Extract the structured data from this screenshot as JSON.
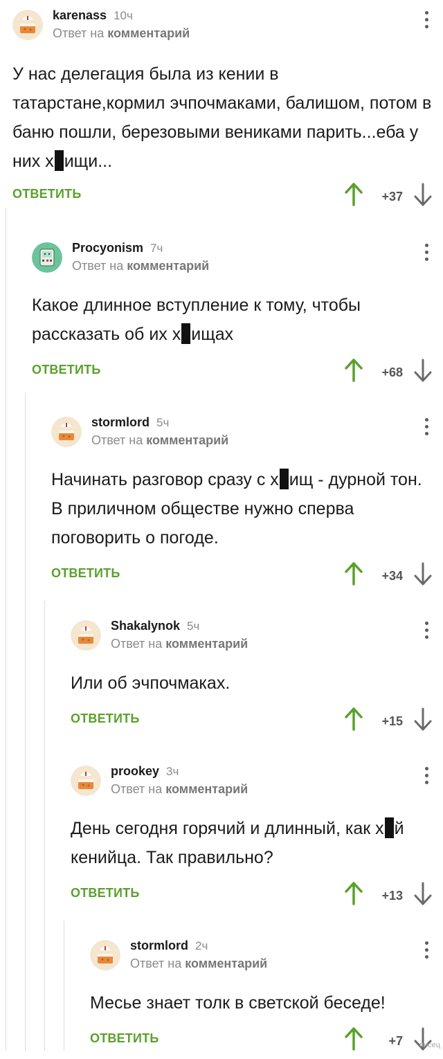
{
  "reply_prefix": "Ответ на",
  "reply_target": "комментарий",
  "answer_label": "ОТВЕТИТЬ",
  "colors": {
    "accent_green": "#5aa02c",
    "muted": "#8a8a8a"
  },
  "watermark": "писец",
  "comments": [
    {
      "user": "karenass",
      "time": "10ч",
      "avatar_icon": "cake-avatar-icon",
      "parts": [
        "У нас делегация была из кении в татарстане,кормил эчпочмаками, балишом, потом в баню пошли, березовыми вениками парить...еба у них х",
        "ищи..."
      ],
      "score": "+37"
    },
    {
      "user": "Procyonism",
      "time": "7ч",
      "avatar_icon": "robot-avatar-icon",
      "parts": [
        "Какое длинное вступление к тому, чтобы рассказать об их х",
        "ищах"
      ],
      "score": "+68"
    },
    {
      "user": "stormlord",
      "time": "5ч",
      "avatar_icon": "cake-avatar-icon",
      "parts": [
        "Начинать разговор сразу с х",
        "ищ - дурной тон. В приличном обществе нужно сперва поговорить о погоде."
      ],
      "score": "+34"
    },
    {
      "user": "Shakalynok",
      "time": "5ч",
      "avatar_icon": "cake-avatar-icon",
      "parts": [
        "Или об эчпочмаках."
      ],
      "score": "+15"
    },
    {
      "user": "prookey",
      "time": "3ч",
      "avatar_icon": "cake-avatar-icon",
      "parts": [
        "День сегодня горячий и длинный, как х",
        "й кенийца. Так правильно?"
      ],
      "score": "+13"
    },
    {
      "user": "stormlord",
      "time": "2ч",
      "avatar_icon": "cake-avatar-icon",
      "parts": [
        "Месье знает толк в светской беседе!"
      ],
      "score": "+7"
    }
  ]
}
